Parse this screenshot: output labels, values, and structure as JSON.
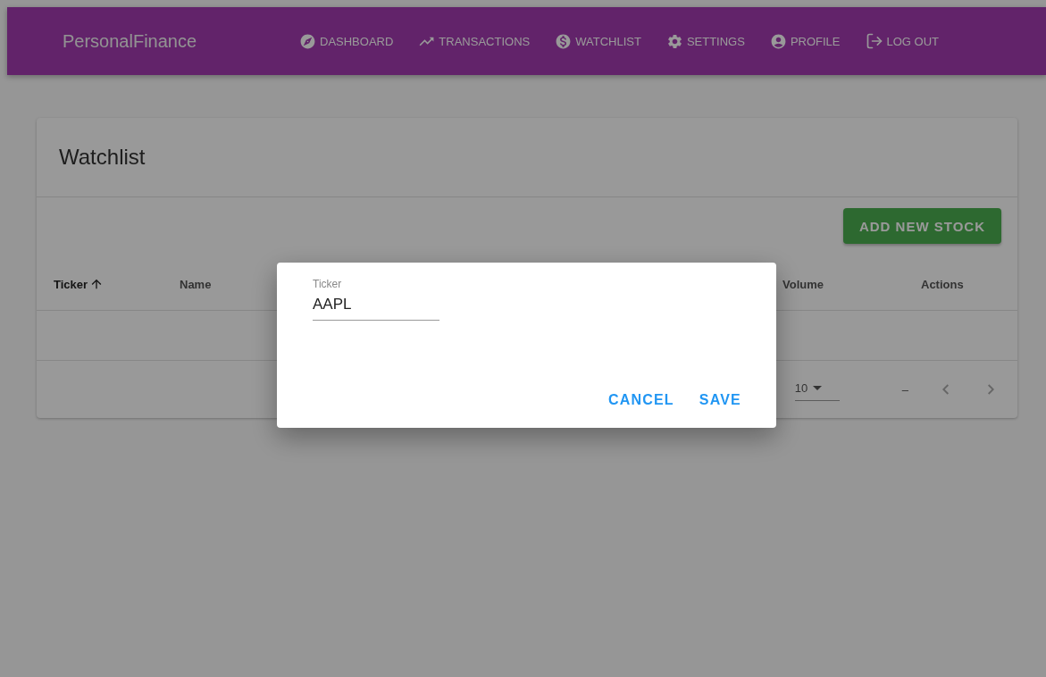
{
  "app_bar": {
    "title": "PersonalFinance",
    "nav": [
      {
        "label": "DASHBOARD",
        "kind": "compass"
      },
      {
        "label": "TRANSACTIONS",
        "kind": "trend"
      },
      {
        "label": "WATCHLIST",
        "kind": "dollar"
      },
      {
        "label": "SETTINGS",
        "kind": "gear"
      },
      {
        "label": "PROFILE",
        "kind": "account"
      },
      {
        "label": "LOG OUT",
        "kind": "logout"
      }
    ]
  },
  "card": {
    "title": "Watchlist",
    "add_button": "ADD NEW STOCK",
    "columns": [
      {
        "label": "Ticker",
        "sorted": true
      },
      {
        "label": "Name",
        "sorted": false
      },
      {
        "label": "Volume",
        "sorted": false
      },
      {
        "label": "Actions",
        "sorted": false
      }
    ],
    "pagination": {
      "rows_per_page": "10",
      "range": "–"
    }
  },
  "dialog": {
    "field": {
      "label": "Ticker",
      "value": "AAPL"
    },
    "buttons": [
      "CANCEL",
      "SAVE"
    ]
  }
}
